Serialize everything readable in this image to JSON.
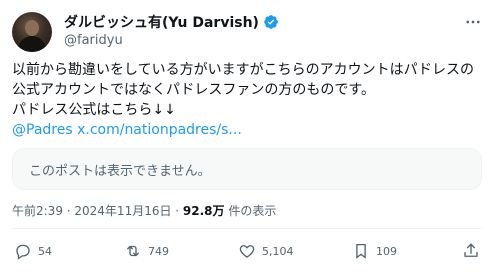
{
  "author": {
    "display_name": "ダルビッシュ有(Yu Darvish)",
    "handle": "@faridyu"
  },
  "tweet": {
    "text": "以前から勘違いをしている方がいますがこちらのアカウントはパドレスの\n公式アカウントではなくパドレスファンの方のものです。\nパドレス公式はこちら↓↓",
    "link_text": "@Padres x.com/nationpadres/s..."
  },
  "quote": {
    "unavailable_text": "このポストは表示できません。"
  },
  "meta": {
    "timestamp": "午前2:39 · 2024年11月16日 · ",
    "views_count": "92.8万",
    "views_label": " 件の表示"
  },
  "actions": {
    "replies": "54",
    "reposts": "749",
    "likes": "5,104",
    "bookmarks": "109"
  },
  "colors": {
    "accent": "#1d9bf0",
    "verified": "#1d9bf0",
    "muted": "#536471",
    "text": "#0f1419"
  },
  "icons": [
    "verified-badge-icon",
    "more-icon",
    "reply-icon",
    "repost-icon",
    "like-icon",
    "bookmark-icon",
    "share-icon"
  ]
}
